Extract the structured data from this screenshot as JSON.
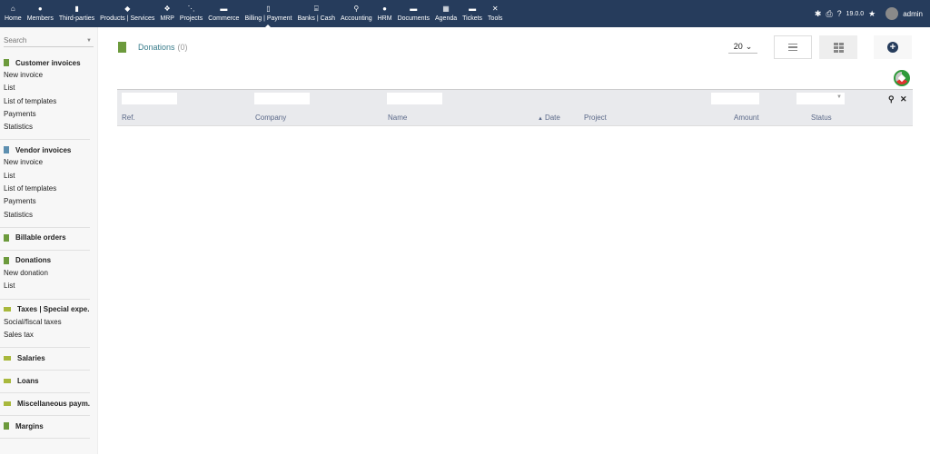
{
  "topbar": {
    "menu": [
      {
        "label": "Home",
        "icon": "home-icon",
        "glyph": "⌂",
        "active": false
      },
      {
        "label": "Members",
        "icon": "user-icon",
        "glyph": "●",
        "active": false
      },
      {
        "label": "Third-parties",
        "icon": "building-icon",
        "glyph": "▮",
        "active": false
      },
      {
        "label": "Products | Services",
        "icon": "cube-icon",
        "glyph": "◆",
        "active": false
      },
      {
        "label": "MRP",
        "icon": "cubes-icon",
        "glyph": "❖",
        "active": false
      },
      {
        "label": "Projects",
        "icon": "sitemap-icon",
        "glyph": "⋱",
        "active": false
      },
      {
        "label": "Commerce",
        "icon": "suitcase-icon",
        "glyph": "▬",
        "active": false
      },
      {
        "label": "Billing | Payment",
        "icon": "file-invoice-icon",
        "glyph": "▯",
        "active": true
      },
      {
        "label": "Banks | Cash",
        "icon": "bank-icon",
        "glyph": "⌸",
        "active": false
      },
      {
        "label": "Accounting",
        "icon": "search-dollar-icon",
        "glyph": "⚲",
        "active": false
      },
      {
        "label": "HRM",
        "icon": "user-tie-icon",
        "glyph": "●",
        "active": false
      },
      {
        "label": "Documents",
        "icon": "folder-icon",
        "glyph": "▬",
        "active": false
      },
      {
        "label": "Agenda",
        "icon": "calendar-icon",
        "glyph": "▦",
        "active": false
      },
      {
        "label": "Tickets",
        "icon": "ticket-icon",
        "glyph": "▬",
        "active": false
      },
      {
        "label": "Tools",
        "icon": "tools-icon",
        "glyph": "✕",
        "active": false
      }
    ],
    "version": "19.0.0",
    "user": "admin"
  },
  "sidebar": {
    "search_placeholder": "Search",
    "sections": [
      {
        "title": "Customer invoices",
        "icon": "invoice-icon",
        "items": [
          "New invoice",
          "List",
          "List of templates",
          "Payments",
          "Statistics"
        ]
      },
      {
        "title": "Vendor invoices",
        "icon": "vendor-invoice-icon",
        "items": [
          "New invoice",
          "List",
          "List of templates",
          "Payments",
          "Statistics"
        ]
      },
      {
        "title": "Billable orders",
        "icon": "billable-orders-icon",
        "items": []
      },
      {
        "title": "Donations",
        "icon": "donation-icon",
        "items": [
          "New donation",
          "List"
        ]
      },
      {
        "title": "Taxes | Special expe...",
        "icon": "money-icon",
        "items": [
          "Social/fiscal taxes",
          "Sales tax"
        ]
      },
      {
        "title": "Salaries",
        "icon": "money-icon",
        "items": []
      },
      {
        "title": "Loans",
        "icon": "money-icon",
        "items": []
      },
      {
        "title": "Miscellaneous paym...",
        "icon": "money-icon",
        "items": []
      },
      {
        "title": "Margins",
        "icon": "margins-icon",
        "items": []
      }
    ]
  },
  "page": {
    "title": "Donations",
    "count": "(0)",
    "limit": "20"
  },
  "table": {
    "columns": [
      "Ref.",
      "Company",
      "Name",
      "Date",
      "Project",
      "Amount",
      "Status"
    ],
    "sort_column": "Date",
    "sort_direction": "asc"
  }
}
